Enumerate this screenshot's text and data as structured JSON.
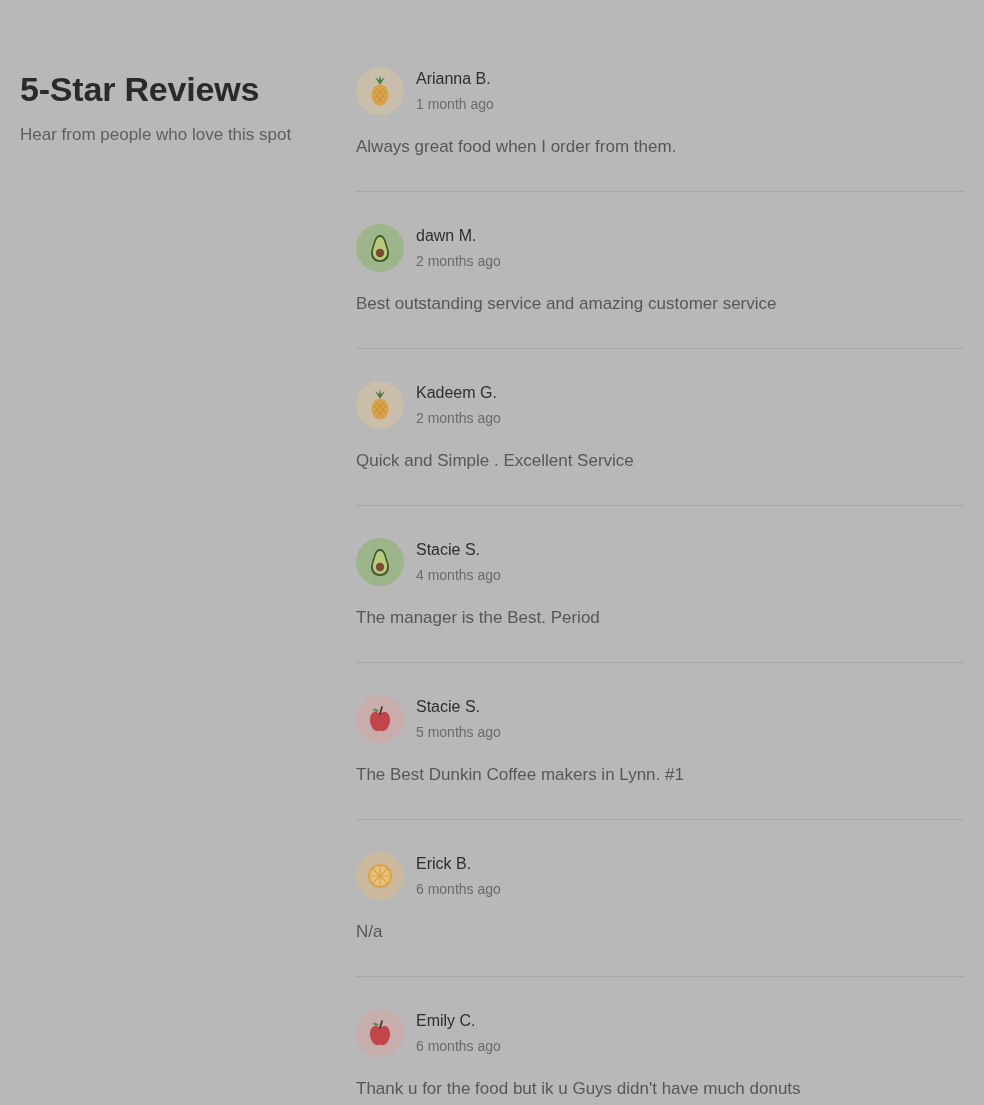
{
  "header": {
    "title": "5-Star Reviews",
    "subtitle": "Hear from people who love this spot"
  },
  "reviews": [
    {
      "kind": "pineapple",
      "name": "Arianna B.",
      "time": "1 month ago",
      "text": "Always great food when I order from them."
    },
    {
      "kind": "avocado",
      "name": "dawn M.",
      "time": "2 months ago",
      "text": "Best outstanding service and amazing customer service"
    },
    {
      "kind": "pineapple",
      "name": "Kadeem G.",
      "time": "2 months ago",
      "text": "Quick and Simple . Excellent Service"
    },
    {
      "kind": "avocado",
      "name": "Stacie S.",
      "time": "4 months ago",
      "text": "The manager is the Best. Period"
    },
    {
      "kind": "apple",
      "name": "Stacie S.",
      "time": "5 months ago",
      "text": "The Best Dunkin Coffee makers in Lynn. #1"
    },
    {
      "kind": "citrus",
      "name": "Erick B.",
      "time": "6 months ago",
      "text": "N/a"
    },
    {
      "kind": "apple",
      "name": "Emily C.",
      "time": "6 months ago",
      "text": "Thank u for the food but ik u Guys didn't have much donuts"
    }
  ]
}
